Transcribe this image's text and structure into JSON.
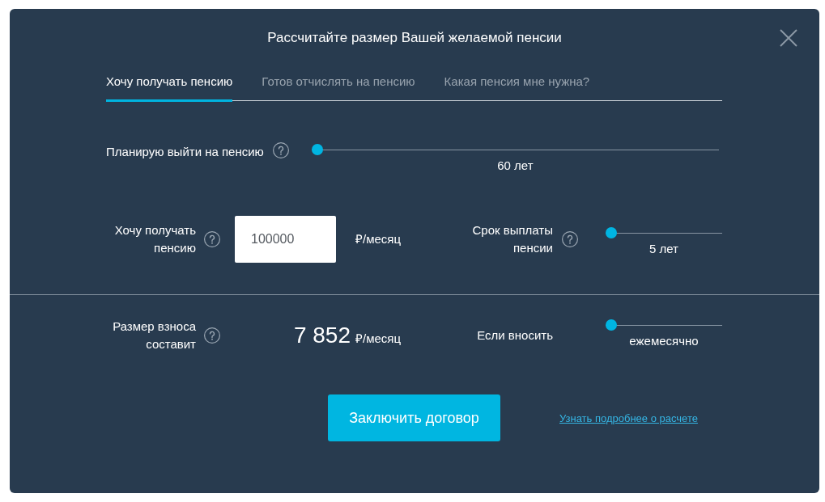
{
  "dialog": {
    "title": "Рассчитайте размер Вашей желаемой пенсии"
  },
  "tabs": [
    {
      "label": "Хочу получать пенсию",
      "selected": true
    },
    {
      "label": "Готов отчислять на пенсию",
      "selected": false
    },
    {
      "label": "Какая пенсия мне нужна?",
      "selected": false
    }
  ],
  "retirement_age": {
    "label": "Планирую выйти на пенсию",
    "level": 0,
    "reading": "60 лет"
  },
  "desired_pension": {
    "label": "Хочу получать пенсию",
    "value": "100000",
    "unit": "₽/месяц"
  },
  "payout_term": {
    "label": "Срок выплаты пенсии",
    "level": 0,
    "reading": "5 лет"
  },
  "contribution": {
    "label": "Размер взноса составит",
    "amount": "7 852",
    "unit": "₽/месяц"
  },
  "frequency": {
    "label": "Если вносить",
    "level": 0,
    "reading": "ежемесячно"
  },
  "actions": {
    "button": "Заключить договор",
    "link": "Узнать подробнее о расчете"
  }
}
